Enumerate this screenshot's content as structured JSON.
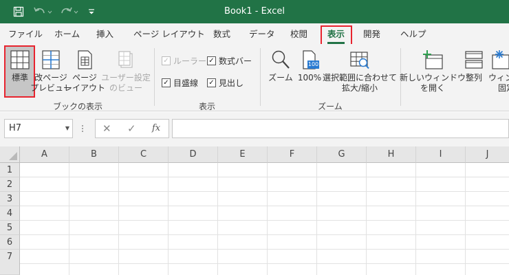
{
  "window": {
    "title": "Book1  -  Excel"
  },
  "tabs": [
    {
      "label": "ファイル"
    },
    {
      "label": "ホーム"
    },
    {
      "label": "挿入"
    },
    {
      "label": "ページ レイアウト"
    },
    {
      "label": "数式"
    },
    {
      "label": "データ"
    },
    {
      "label": "校閲"
    },
    {
      "label": "表示",
      "active": true
    },
    {
      "label": "開発"
    },
    {
      "label": "ヘルプ"
    }
  ],
  "ribbon": {
    "workbook_views": {
      "group_label": "ブックの表示",
      "normal": {
        "label": "標準",
        "selected": true
      },
      "page_break": {
        "line1": "改ページ",
        "line2": "プレビュー"
      },
      "page_layout": {
        "line1": "ページ",
        "line2": "レイアウト"
      },
      "custom_views": {
        "line1": "ユーザー設定",
        "line2": "のビュー",
        "disabled": true
      }
    },
    "show": {
      "group_label": "表示",
      "ruler": {
        "label": "ルーラー",
        "checked": true,
        "disabled": true
      },
      "formula_bar": {
        "label": "数式バー",
        "checked": true
      },
      "gridlines": {
        "label": "目盛線",
        "checked": true
      },
      "headings": {
        "label": "見出し",
        "checked": true
      }
    },
    "zoom": {
      "group_label": "ズーム",
      "zoom": {
        "label": "ズーム"
      },
      "zoom100": {
        "label": "100%",
        "icon_text": "100"
      },
      "zoom_selection": {
        "line1": "選択範囲に合わせて",
        "line2": "拡大/縮小"
      }
    },
    "window": {
      "new_window": {
        "line1": "新しいウィンドウ",
        "line2": "を開く"
      },
      "arrange": {
        "label": "整列"
      },
      "freeze": {
        "line1": "ウィンド",
        "line2": "固定"
      }
    }
  },
  "formula_bar": {
    "name_box": "H7",
    "cancel_symbol": "✕",
    "enter_symbol": "✓",
    "fx_symbol": "fx",
    "value": ""
  },
  "sheet": {
    "columns": [
      "A",
      "B",
      "C",
      "D",
      "E",
      "F",
      "G",
      "H",
      "I",
      "J"
    ],
    "rows": [
      "1",
      "2",
      "3",
      "4",
      "5",
      "6",
      "7"
    ]
  },
  "colors": {
    "accent": "#217346",
    "highlight": "#e8232e"
  }
}
